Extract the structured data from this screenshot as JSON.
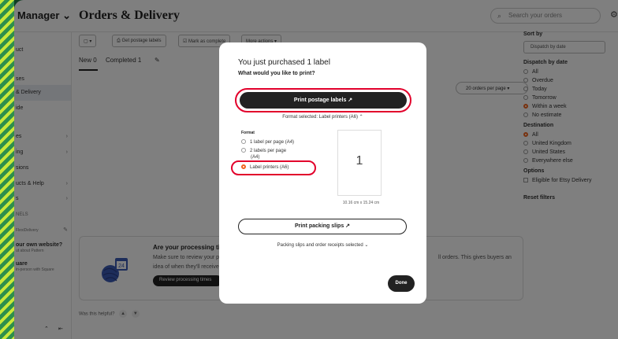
{
  "app": {
    "brand": "Manager",
    "brand_chev": "⌄",
    "page_title": "Orders & Delivery",
    "search_placeholder": "Search your orders",
    "gear_icon": "⚙"
  },
  "sidebar": {
    "items": [
      {
        "label": "uct"
      },
      {
        "label": "ses"
      },
      {
        "label": "& Delivery"
      },
      {
        "label": "ide"
      },
      {
        "label": "es"
      },
      {
        "label": "ing"
      },
      {
        "label": "sions"
      },
      {
        "label": "ucts & Help"
      },
      {
        "label": "s"
      },
      {
        "label": "NELS"
      },
      {
        "label": "our own website?"
      },
      {
        "label": "ut about Pattern"
      },
      {
        "label": "uare"
      },
      {
        "label": "in-person with Square"
      }
    ],
    "pin_label": "FlexiDelivery",
    "footer_icons": [
      "⌃",
      "⇤"
    ]
  },
  "toolbar": {
    "select_label": "▢ ▾",
    "get_labels": "⎙ Get postage labels",
    "mark_complete": "☑ Mark as complete",
    "more_actions": "More actions ▾"
  },
  "tabs": {
    "new": "New 0",
    "completed": "Completed 1",
    "edit_icon": "✎"
  },
  "per_page": "20 orders per page ▾",
  "filters": {
    "sort_by": "Sort by",
    "sort_value": "Dispatch by date",
    "dispatch_by_date": "Dispatch by date",
    "dispatch_options": [
      "All",
      "Overdue",
      "Today",
      "Tomorrow",
      "Within a week",
      "No estimate"
    ],
    "destination": "Destination",
    "destination_options": [
      "All",
      "United Kingdom",
      "United States",
      "Everywhere else"
    ],
    "options": "Options",
    "option_items": [
      "Eligible for Etsy Delivery"
    ],
    "reset": "Reset filters"
  },
  "banner": {
    "title": "Are your processing times ac",
    "text1": "Make sure to review your pro",
    "text2": "idea of when they'll receive t",
    "text3": "ll orders. This gives buyers an",
    "button": "Review processing times"
  },
  "helpful": {
    "label": "Was this helpful?",
    "up": "👍",
    "down": "👎"
  },
  "modal": {
    "title": "You just purchased 1 label",
    "subtitle": "What would you like to print?",
    "print_postage": "Print postage labels ↗",
    "format_selected": "Format selected: Label printers (A6)  ⌃",
    "format_label": "Format",
    "options": [
      "1 label per page (A4)",
      "2 labels per page",
      "(A4)",
      "Label printers (A6)"
    ],
    "preview_number": "1",
    "preview_caption": "10.16 cm x 15.24 cm",
    "print_packing": "Print packing slips ↗",
    "packing_selected": "Packing slips and order receipts selected  ⌄",
    "done": "Done"
  }
}
